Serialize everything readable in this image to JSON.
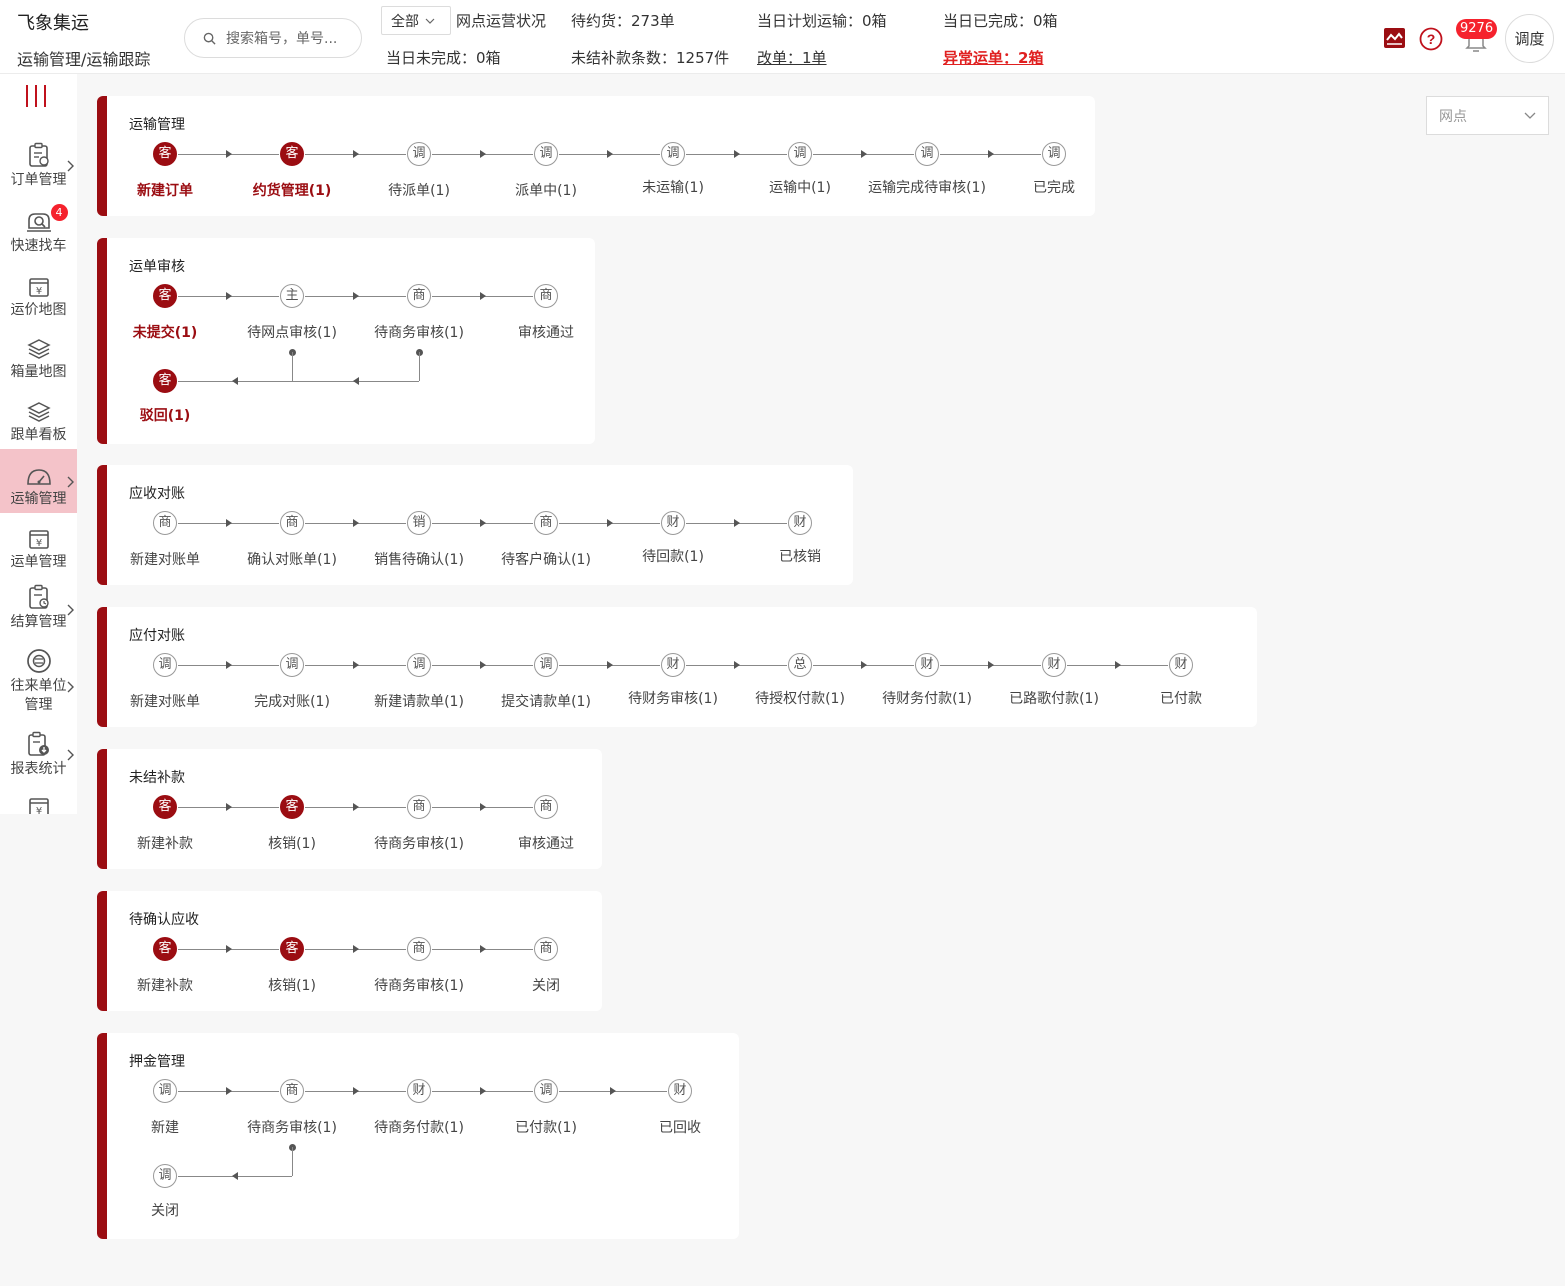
{
  "header": {
    "app_title": "飞象集运",
    "breadcrumb": "运输管理/运输跟踪",
    "search_placeholder": "搜索箱号，单号...",
    "filter_value": "全部",
    "stats": {
      "network_status": "网点运营状况",
      "pending_pickup": "待约货：273单",
      "planned_today": "当日计划运输：0箱",
      "completed_today": "当日已完成：0箱",
      "unfinished_today": "当日未完成：0箱",
      "unsettled_subsidy": "未结补款条数：1257件",
      "modified_orders": "改单：1单",
      "abnormal_orders": "异常运单：2箱"
    },
    "notification_count": "9276",
    "dispatch_label": "调度"
  },
  "sidebar": {
    "items": [
      {
        "label": "订单管理",
        "icon": "clipboard-icon",
        "has_submenu": true
      },
      {
        "label": "快速找车",
        "icon": "car-search-icon",
        "badge": "4"
      },
      {
        "label": "运价地图",
        "icon": "price-map-icon"
      },
      {
        "label": "箱量地图",
        "icon": "layers-icon"
      },
      {
        "label": "跟单看板",
        "icon": "layers-icon"
      },
      {
        "label": "运输管理",
        "icon": "dashboard-gauge-icon",
        "has_submenu": true,
        "active": true
      },
      {
        "label": "运单管理",
        "icon": "yuan-doc-icon"
      },
      {
        "label": "结算管理",
        "icon": "clipboard-clock-icon",
        "has_submenu": true
      },
      {
        "label": "往来单位管理",
        "label_lines": [
          "往来单位",
          "管理"
        ],
        "icon": "partner-icon",
        "has_submenu": true
      },
      {
        "label": "报表统计",
        "icon": "report-icon",
        "has_submenu": true
      }
    ]
  },
  "network_filter": {
    "placeholder": "网点"
  },
  "workflows": [
    {
      "title": "运输管理",
      "steps": [
        {
          "node": "客",
          "label": "新建订单",
          "filled": true,
          "red": true
        },
        {
          "node": "客",
          "label": "约货管理(1)",
          "filled": true,
          "red": true
        },
        {
          "node": "调",
          "label": "待派单(1)"
        },
        {
          "node": "调",
          "label": "派单中(1)"
        },
        {
          "node": "调",
          "label": "未运输(1)"
        },
        {
          "node": "调",
          "label": "运输中(1)"
        },
        {
          "node": "调",
          "label": "运输完成待审核(1)"
        },
        {
          "node": "调",
          "label": "已完成"
        }
      ]
    },
    {
      "title": "运单审核",
      "steps": [
        {
          "node": "客",
          "label": "未提交(1)",
          "filled": true,
          "red": true
        },
        {
          "node": "主",
          "label": "待网点审核(1)"
        },
        {
          "node": "商",
          "label": "待商务审核(1)"
        },
        {
          "node": "商",
          "label": "审核通过"
        }
      ],
      "return_step": {
        "node": "客",
        "label": "驳回(1)",
        "filled": true,
        "red": true
      }
    },
    {
      "title": "应收对账",
      "steps": [
        {
          "node": "商",
          "label": "新建对账单"
        },
        {
          "node": "商",
          "label": "确认对账单(1)"
        },
        {
          "node": "销",
          "label": "销售待确认(1)"
        },
        {
          "node": "商",
          "label": "待客户确认(1)"
        },
        {
          "node": "财",
          "label": "待回款(1)"
        },
        {
          "node": "财",
          "label": "已核销"
        }
      ]
    },
    {
      "title": "应付对账",
      "steps": [
        {
          "node": "调",
          "label": "新建对账单"
        },
        {
          "node": "调",
          "label": "完成对账(1)"
        },
        {
          "node": "调",
          "label": "新建请款单(1)"
        },
        {
          "node": "调",
          "label": "提交请款单(1)"
        },
        {
          "node": "财",
          "label": "待财务审核(1)"
        },
        {
          "node": "总",
          "label": "待授权付款(1)"
        },
        {
          "node": "财",
          "label": "待财务付款(1)"
        },
        {
          "node": "财",
          "label": "已路歌付款(1)"
        },
        {
          "node": "财",
          "label": "已付款"
        }
      ]
    },
    {
      "title": "未结补款",
      "steps": [
        {
          "node": "客",
          "label": "新建补款",
          "filled": true
        },
        {
          "node": "客",
          "label": "核销(1)",
          "filled": true
        },
        {
          "node": "商",
          "label": "待商务审核(1)"
        },
        {
          "node": "商",
          "label": "审核通过"
        }
      ]
    },
    {
      "title": "待确认应收",
      "steps": [
        {
          "node": "客",
          "label": "新建补款",
          "filled": true
        },
        {
          "node": "客",
          "label": "核销(1)",
          "filled": true
        },
        {
          "node": "商",
          "label": "待商务审核(1)"
        },
        {
          "node": "商",
          "label": "关闭"
        }
      ]
    },
    {
      "title": "押金管理",
      "steps": [
        {
          "node": "调",
          "label": "新建"
        },
        {
          "node": "商",
          "label": "待商务审核(1)"
        },
        {
          "node": "财",
          "label": "待商务付款(1)"
        },
        {
          "node": "调",
          "label": "已付款(1)"
        },
        {
          "node": "财",
          "label": "已回收"
        }
      ],
      "return_step": {
        "node": "调",
        "label": "关闭"
      }
    }
  ]
}
